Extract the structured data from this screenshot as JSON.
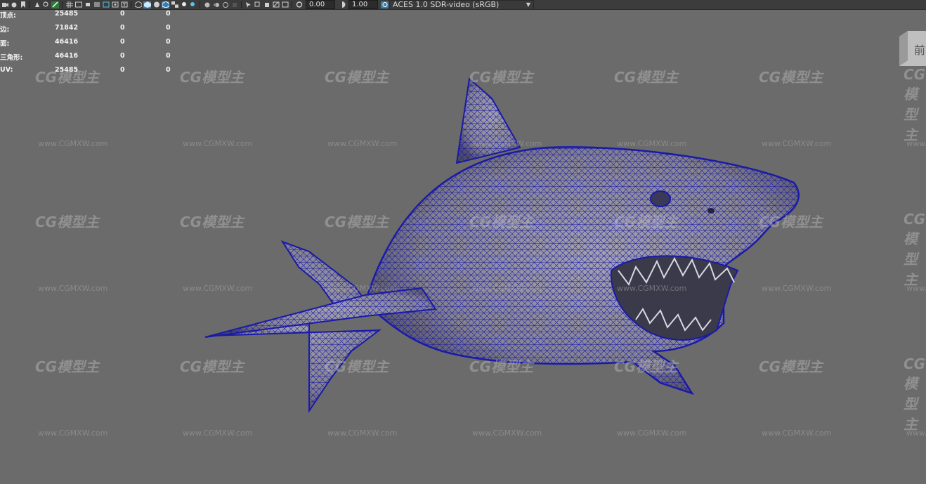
{
  "toolbar": {
    "exposure_value": "0.00",
    "gamma_value": "1.00",
    "color_space": "ACES 1.0 SDR-video (sRGB)"
  },
  "hud": {
    "rows": [
      {
        "label": "顶点:",
        "v1": "25485",
        "v2": "0",
        "v3": "0"
      },
      {
        "label": "边:",
        "v1": "71842",
        "v2": "0",
        "v3": "0"
      },
      {
        "label": "面:",
        "v1": "46416",
        "v2": "0",
        "v3": "0"
      },
      {
        "label": "三角形:",
        "v1": "46416",
        "v2": "0",
        "v3": "0"
      },
      {
        "label": "UV:",
        "v1": "25485",
        "v2": "0",
        "v3": "0"
      }
    ]
  },
  "view_cube": {
    "label": "前"
  },
  "watermark": {
    "logo": "CG模型主",
    "url": "www.CGMXW.com"
  },
  "colors": {
    "viewport_bg": "#6b6b6b",
    "wire": "#1a1aa8",
    "toolbar_bg": "#3c3c3c"
  }
}
